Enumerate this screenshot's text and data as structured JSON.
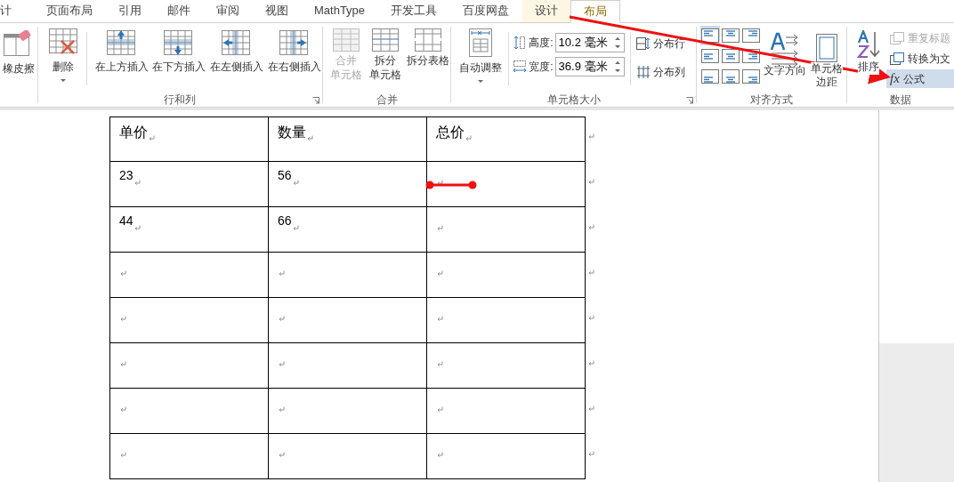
{
  "tabs": [
    {
      "label": "计",
      "selected": false,
      "kind": "normal"
    },
    {
      "label": "页面布局",
      "selected": false,
      "kind": "normal"
    },
    {
      "label": "引用",
      "selected": false,
      "kind": "normal"
    },
    {
      "label": "邮件",
      "selected": false,
      "kind": "normal"
    },
    {
      "label": "审阅",
      "selected": false,
      "kind": "normal"
    },
    {
      "label": "视图",
      "selected": false,
      "kind": "normal"
    },
    {
      "label": "MathType",
      "selected": false,
      "kind": "normal"
    },
    {
      "label": "开发工具",
      "selected": false,
      "kind": "normal"
    },
    {
      "label": "百度网盘",
      "selected": false,
      "kind": "normal"
    },
    {
      "label": "设计",
      "selected": false,
      "kind": "contextual"
    },
    {
      "label": "布局",
      "selected": true,
      "kind": "contextual"
    }
  ],
  "ribbon": {
    "draw": {
      "eraser": "橡皮擦"
    },
    "rows_columns": {
      "title": "行和列",
      "delete": "删除",
      "inserts": [
        "在上方插入",
        "在下方插入",
        "在左侧插入",
        "在右侧插入"
      ]
    },
    "merge": {
      "title": "合并",
      "buttons": [
        {
          "lines": [
            "合并",
            "单元格"
          ],
          "disabled": true
        },
        {
          "lines": [
            "拆分",
            "单元格"
          ],
          "disabled": false
        },
        {
          "lines": [
            "拆分表格"
          ],
          "disabled": false
        }
      ]
    },
    "cell_size": {
      "title": "单元格大小",
      "autofit": "自动调整",
      "height": {
        "label": "高度:",
        "value": "10.2 毫米"
      },
      "width": {
        "label": "宽度:",
        "value": "36.9 毫米"
      },
      "distribute": [
        "分布行",
        "分布列"
      ]
    },
    "alignment": {
      "title": "对齐方式",
      "aligns": [
        {
          "selected": true
        },
        {
          "selected": false
        },
        {
          "selected": false
        },
        {
          "selected": false
        },
        {
          "selected": false
        },
        {
          "selected": false
        },
        {
          "selected": false
        },
        {
          "selected": false
        },
        {
          "selected": false
        }
      ],
      "text_direction": "文字方向",
      "cell_margins": [
        "单元格",
        "边距"
      ]
    },
    "data": {
      "title": "数据",
      "sort": "排序",
      "items": [
        {
          "label": "重复标题",
          "disabled": true,
          "selected": false
        },
        {
          "label": "转换为文",
          "disabled": false,
          "selected": false
        },
        {
          "label": "公式",
          "icon_text": "fx",
          "disabled": false,
          "selected": true
        }
      ]
    }
  },
  "table": {
    "rows": [
      {
        "cells": [
          "单价",
          "数量",
          "总价"
        ]
      },
      {
        "cells": [
          "23",
          "56",
          null
        ]
      },
      {
        "cells": [
          "44",
          "66",
          null
        ]
      },
      {
        "cells": [
          null,
          null,
          null
        ]
      },
      {
        "cells": [
          null,
          null,
          null
        ]
      },
      {
        "cells": [
          null,
          null,
          null
        ]
      },
      {
        "cells": [
          null,
          null,
          null
        ]
      },
      {
        "cells": [
          null,
          null,
          null
        ]
      }
    ]
  }
}
